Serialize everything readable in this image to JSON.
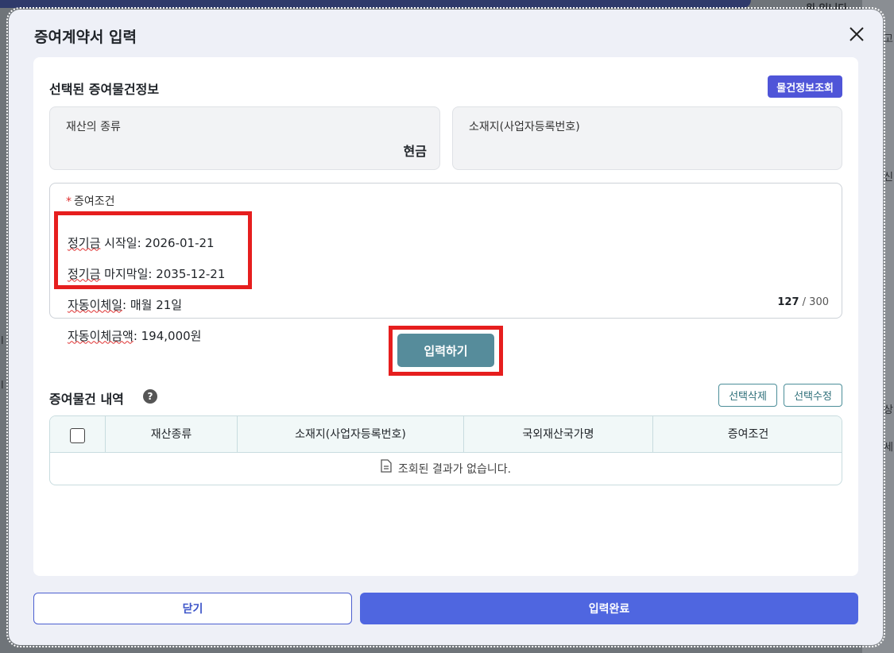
{
  "background": {
    "right_fragments": [
      "원 입니다.",
      "고",
      "신",
      "상",
      "세"
    ],
    "left_fragments": [
      "l",
      "l"
    ]
  },
  "modal": {
    "title": "증여계약서 입력",
    "close_icon": "close-icon"
  },
  "selected_item": {
    "section_title": "선택된 증여물건정보",
    "lookup_button": "물건정보조회",
    "asset_type_label": "재산의 종류",
    "asset_type_value": "현금",
    "location_label": "소재지(사업자등록번호)",
    "location_value": ""
  },
  "condition": {
    "required_mark": "*",
    "label": "증여조건",
    "lines": [
      {
        "key": "정기금",
        "rest": " 시작일: 2026-01-21"
      },
      {
        "key": "정기금",
        "rest": " 마지막일: 2035-12-21"
      },
      {
        "key": "자동이체일",
        "rest": ": 매월 21일"
      },
      {
        "key": "자동이체금액",
        "rest": ": 194,000원"
      }
    ],
    "count": "127",
    "max": "/ 300"
  },
  "input_button": "입력하기",
  "history": {
    "title": "증여물건 내역",
    "help_icon": "question-circle-icon",
    "delete_button": "선택삭제",
    "edit_button": "선택수정",
    "columns": [
      "재산종류",
      "소재지(사업자등록번호)",
      "국외재산국가명",
      "증여조건"
    ],
    "empty_message": "조회된 결과가 없습니다."
  },
  "footer": {
    "close_button": "닫기",
    "complete_button": "입력완료"
  },
  "colors": {
    "primary": "#4f66e0",
    "lookup": "#4f55d8",
    "teal": "#568c9b",
    "highlight": "#e61e1e"
  }
}
